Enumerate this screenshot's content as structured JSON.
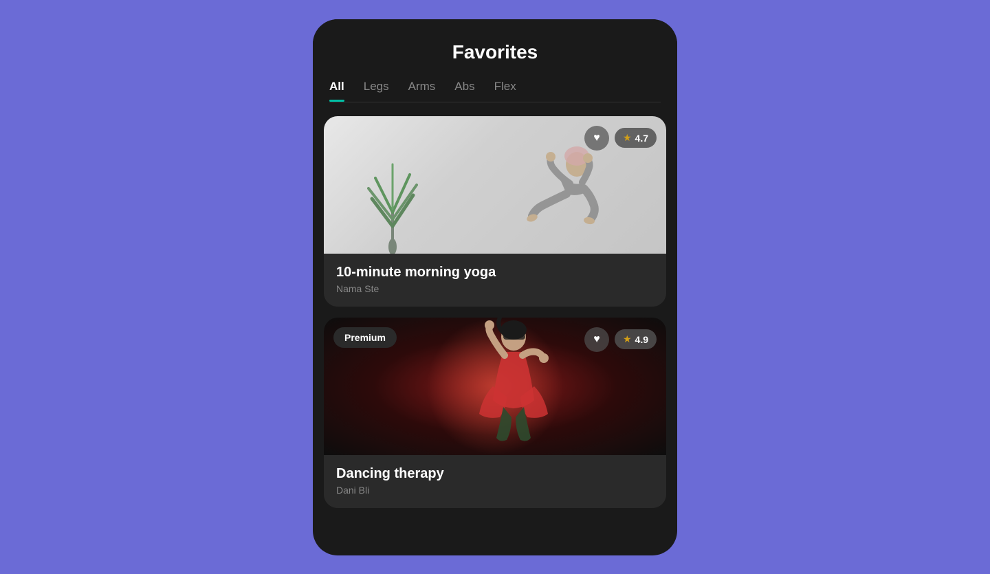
{
  "page": {
    "title": "Favorites",
    "background_color": "#6B6BD6"
  },
  "tabs": {
    "items": [
      {
        "id": "all",
        "label": "All",
        "active": true
      },
      {
        "id": "legs",
        "label": "Legs",
        "active": false
      },
      {
        "id": "arms",
        "label": "Arms",
        "active": false
      },
      {
        "id": "abs",
        "label": "Abs",
        "active": false
      },
      {
        "id": "flex",
        "label": "Flex",
        "active": false
      }
    ],
    "accent_color": "#00BFA5"
  },
  "cards": [
    {
      "id": "yoga",
      "title": "10-minute morning yoga",
      "subtitle": "Nama Ste",
      "rating": "4.7",
      "is_premium": false,
      "is_favorited": true
    },
    {
      "id": "dance",
      "title": "Dancing therapy",
      "subtitle": "Dani Bli",
      "rating": "4.9",
      "is_premium": true,
      "is_favorited": true
    }
  ],
  "icons": {
    "heart": "♥",
    "star": "★",
    "premium_label": "Premium"
  }
}
